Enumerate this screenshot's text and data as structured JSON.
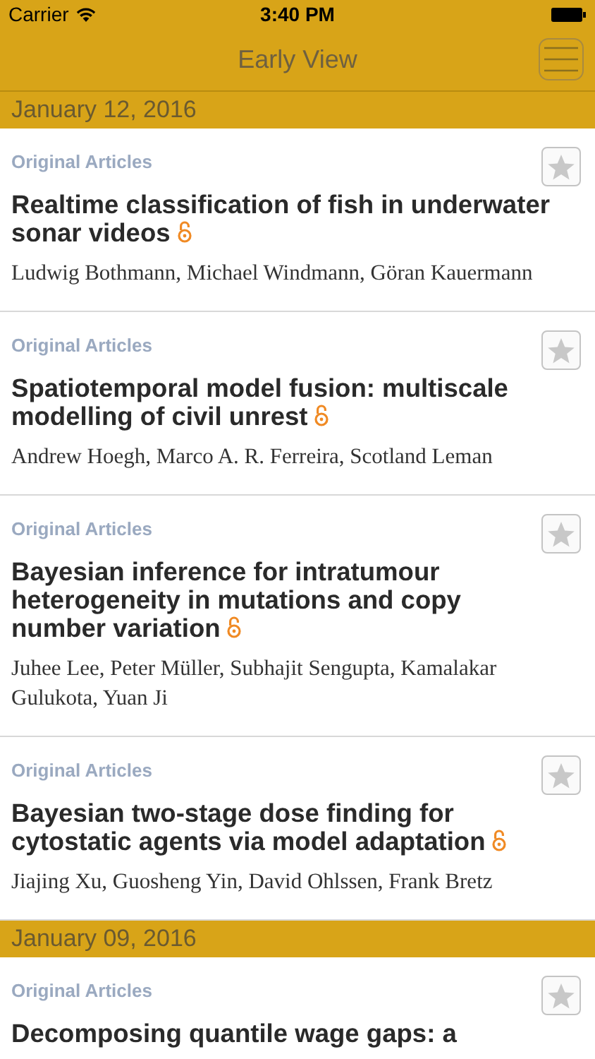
{
  "status_bar": {
    "carrier": "Carrier",
    "time": "3:40 PM"
  },
  "nav_bar": {
    "title": "Early View"
  },
  "sections": [
    {
      "date": "January 12, 2016",
      "articles": [
        {
          "category": "Original Articles",
          "title": "Realtime classification of fish in underwater sonar videos",
          "open_access": true,
          "starred": false,
          "authors": "Ludwig Bothmann, Michael Windmann, Göran Kauermann"
        },
        {
          "category": "Original Articles",
          "title": "Spatiotemporal model fusion: multiscale modelling of civil unrest",
          "open_access": true,
          "starred": false,
          "authors": "Andrew Hoegh, Marco A. R. Ferreira, Scotland Leman"
        },
        {
          "category": "Original Articles",
          "title": "Bayesian inference for intratumour heterogeneity in mutations and copy number variation",
          "open_access": true,
          "starred": false,
          "authors": "Juhee Lee, Peter Müller, Subhajit Sengupta, Kamalakar Gulukota, Yuan Ji"
        },
        {
          "category": "Original Articles",
          "title": "Bayesian two-stage dose finding for cytostatic agents via model adaptation",
          "open_access": true,
          "starred": false,
          "authors": "Jiajing Xu, Guosheng Yin, David Ohlssen, Frank Bretz"
        }
      ]
    },
    {
      "date": "January 09, 2016",
      "articles": [
        {
          "category": "Original Articles",
          "title": "Decomposing quantile wage gaps: a",
          "open_access": false,
          "starred": false
        }
      ]
    }
  ]
}
